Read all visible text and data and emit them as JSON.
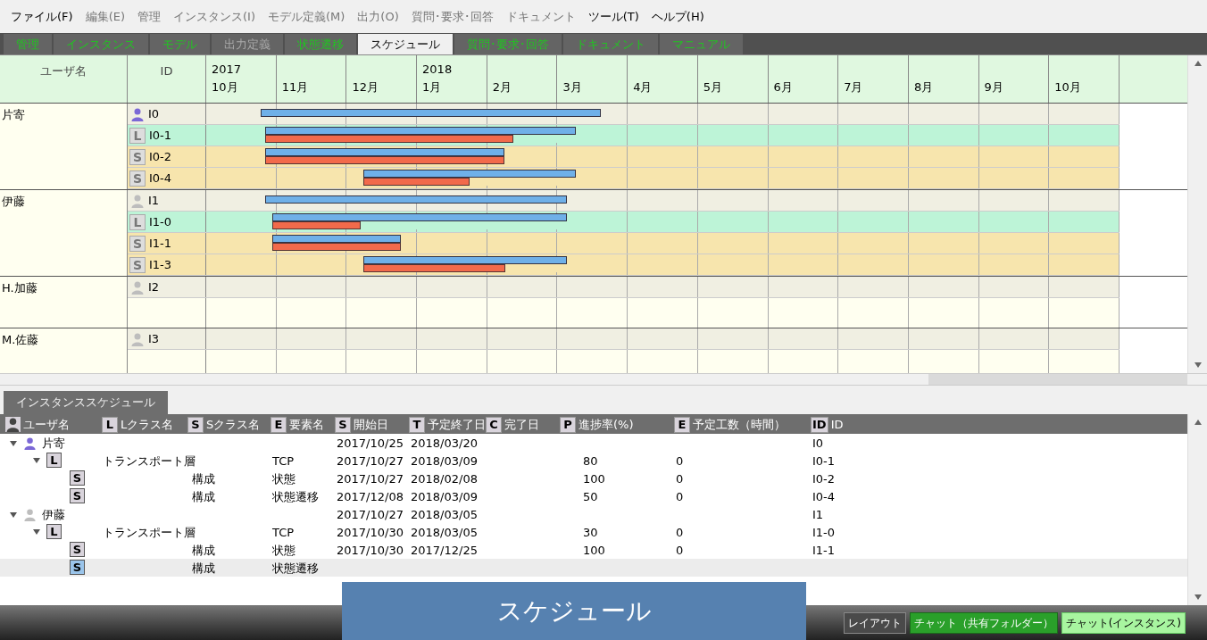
{
  "menu": [
    {
      "label": "ファイル(F)",
      "disabled": false
    },
    {
      "label": "編集(E)",
      "disabled": true
    },
    {
      "label": "管理",
      "disabled": true
    },
    {
      "label": "インスタンス(I)",
      "disabled": true
    },
    {
      "label": "モデル定義(M)",
      "disabled": true
    },
    {
      "label": "出力(O)",
      "disabled": true
    },
    {
      "label": "質問･要求･回答",
      "disabled": true
    },
    {
      "label": "ドキュメント",
      "disabled": true
    },
    {
      "label": "ツール(T)",
      "disabled": false
    },
    {
      "label": "ヘルプ(H)",
      "disabled": false
    }
  ],
  "tabs": [
    {
      "label": "管理",
      "selected": false,
      "disabled": false
    },
    {
      "label": "インスタンス",
      "selected": false,
      "disabled": false
    },
    {
      "label": "モデル",
      "selected": false,
      "disabled": false
    },
    {
      "label": "出力定義",
      "selected": false,
      "disabled": true
    },
    {
      "label": "状態遷移",
      "selected": false,
      "disabled": false
    },
    {
      "label": "スケジュール",
      "selected": true,
      "disabled": false
    },
    {
      "label": "質問･要求･回答",
      "selected": false,
      "disabled": false
    },
    {
      "label": "ドキュメント",
      "selected": false,
      "disabled": false
    },
    {
      "label": "マニュアル",
      "selected": false,
      "disabled": false
    }
  ],
  "gantt": {
    "columns": [
      "ユーザ名",
      "ID"
    ],
    "groups": [
      {
        "user": "片寄",
        "rows": [
          {
            "kind": "user",
            "color": "#7b68d6",
            "id": "I0"
          },
          {
            "kind": "L",
            "badge": "L",
            "id": "I0-1",
            "level": 0.8
          },
          {
            "kind": "S",
            "badge": "S",
            "id": "I0-2",
            "level": 1
          },
          {
            "kind": "S",
            "badge": "S",
            "id": "I0-4",
            "level": 0.5
          }
        ]
      },
      {
        "user": "伊藤",
        "rows": [
          {
            "kind": "user",
            "color": "#bdbdbd",
            "id": "I1"
          },
          {
            "kind": "L",
            "badge": "L",
            "id": "I1-0",
            "level": 0.3
          },
          {
            "kind": "S",
            "badge": "S",
            "id": "I1-1",
            "level": 1
          },
          {
            "kind": "S",
            "badge": "S",
            "id": "I1-3",
            "level": 0.7
          }
        ]
      },
      {
        "user": "H.加藤",
        "rows": [
          {
            "kind": "user",
            "color": "#bdbdbd",
            "id": "I2"
          }
        ]
      },
      {
        "user": "M.佐藤",
        "rows": [
          {
            "kind": "user",
            "color": "#bdbdbd",
            "id": "I3"
          }
        ]
      }
    ],
    "months": [
      {
        "label": "10月",
        "year": "2017"
      },
      {
        "label": "11月"
      },
      {
        "label": "12月"
      },
      {
        "label": "1月",
        "year": "2018"
      },
      {
        "label": "2月"
      },
      {
        "label": "3月"
      },
      {
        "label": "4月"
      },
      {
        "label": "5月"
      },
      {
        "label": "6月"
      },
      {
        "label": "7月"
      },
      {
        "label": "8月"
      },
      {
        "label": "9月"
      },
      {
        "label": "10月"
      }
    ]
  },
  "panel_tab": "インスタンススケジュール",
  "table": {
    "columns": [
      {
        "kind": "user",
        "label": "ユーザ名"
      },
      {
        "kind": "badge",
        "badge": "L",
        "label": "Lクラス名"
      },
      {
        "kind": "badge",
        "badge": "S",
        "label": "Sクラス名"
      },
      {
        "kind": "badge",
        "badge": "E",
        "label": "要素名"
      },
      {
        "kind": "badge",
        "badge": "S",
        "label": "開始日"
      },
      {
        "kind": "badge",
        "badge": "T",
        "label": "予定終了日"
      },
      {
        "kind": "badge",
        "badge": "C",
        "label": "完了日"
      },
      {
        "kind": "badge",
        "badge": "P",
        "label": "進捗率(%)"
      },
      {
        "kind": "badge",
        "badge": "E",
        "label": "予定工数（時間）"
      },
      {
        "kind": "badge",
        "badge": "ID",
        "label": "ID"
      }
    ],
    "rows": [
      {
        "kind": "user",
        "name": "片寄",
        "color": "#7b68d6",
        "expanded": true,
        "selected": false,
        "start": "2017/10/25",
        "end": "2018/03/20",
        "id": "I0",
        "children": [
          {
            "badge": "L",
            "lclass": "トランスポート層",
            "element": "TCP",
            "expanded": true,
            "selected": false,
            "start": "2017/10/27",
            "end": "2018/03/09",
            "progress": "80",
            "effort": "0",
            "id": "I0-1",
            "children": [
              {
                "badge": "S",
                "sclass": "構成",
                "element": "状態",
                "selected": false,
                "start": "2017/10/27",
                "end": "2018/02/08",
                "progress": "100",
                "effort": "0",
                "id": "I0-2"
              },
              {
                "badge": "S",
                "sclass": "構成",
                "element": "状態遷移",
                "selected": false,
                "start": "2017/12/08",
                "end": "2018/03/09",
                "progress": "50",
                "effort": "0",
                "id": "I0-4"
              }
            ]
          }
        ]
      },
      {
        "kind": "user",
        "name": "伊藤",
        "color": "#bdbdbd",
        "expanded": true,
        "selected": false,
        "start": "2017/10/27",
        "end": "2018/03/05",
        "id": "I1",
        "children": [
          {
            "badge": "L",
            "lclass": "トランスポート層",
            "element": "TCP",
            "expanded": true,
            "selected": false,
            "start": "2017/10/30",
            "end": "2018/03/05",
            "progress": "30",
            "effort": "0",
            "id": "I1-0",
            "children": [
              {
                "badge": "S",
                "sclass": "構成",
                "element": "状態",
                "selected": false,
                "start": "2017/10/30",
                "end": "2017/12/25",
                "progress": "100",
                "effort": "0",
                "id": "I1-1"
              },
              {
                "badge": "S",
                "sclass": "構成",
                "element": "状態遷移",
                "selected": true
              }
            ]
          }
        ]
      }
    ]
  },
  "status_buttons": [
    {
      "label": "レイアウト",
      "kind": "plain"
    },
    {
      "label": "チャット（共有フォルダー）",
      "kind": "green"
    },
    {
      "label": "チャット(インスタンス)",
      "kind": "light"
    }
  ],
  "caption": "スケジュール"
}
